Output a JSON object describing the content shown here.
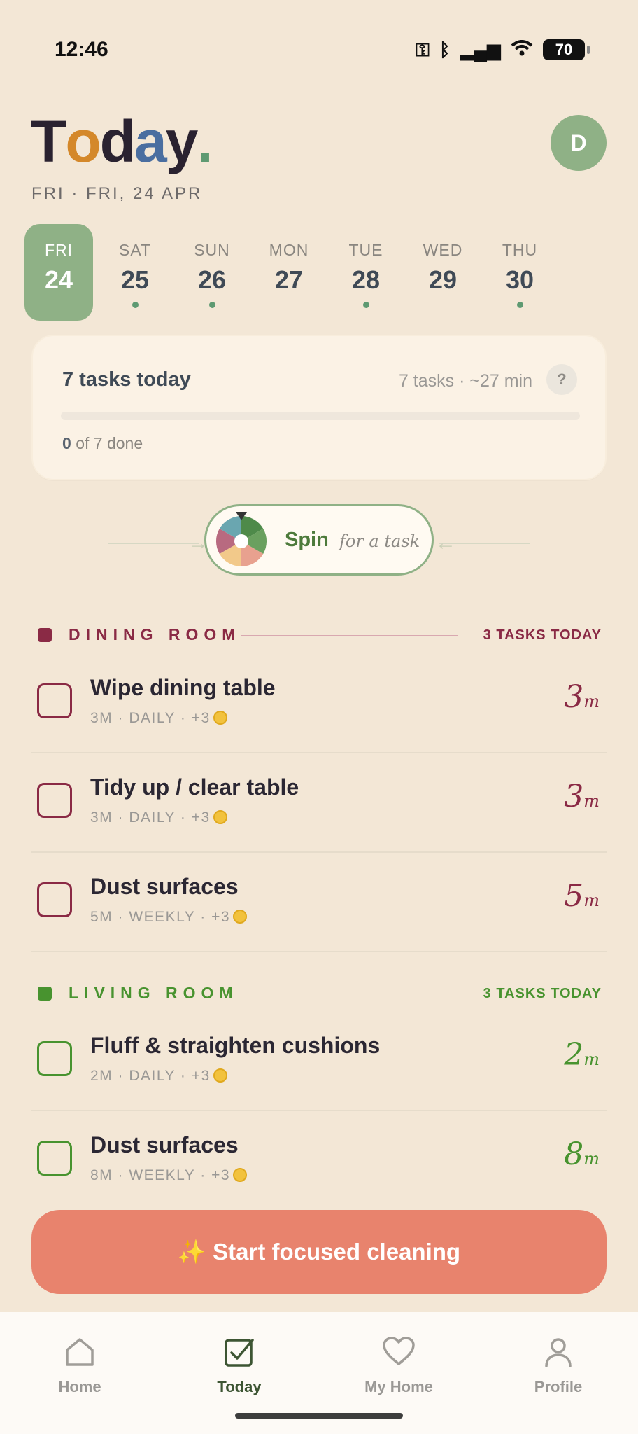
{
  "status_bar": {
    "time": "12:46",
    "battery": "70"
  },
  "header": {
    "title_letters": [
      {
        "ch": "T",
        "color": "#2a2230"
      },
      {
        "ch": "o",
        "color": "#d4882a"
      },
      {
        "ch": "d",
        "color": "#2a2230"
      },
      {
        "ch": "a",
        "color": "#4a6ea0"
      },
      {
        "ch": "y",
        "color": "#2a2230"
      },
      {
        "ch": ".",
        "color": "#5e9a72"
      }
    ],
    "subtitle": "FRI · FRI, 24 APR",
    "avatar_initial": "D"
  },
  "week": [
    {
      "name": "FRI",
      "num": "24",
      "active": true,
      "dot": false
    },
    {
      "name": "SAT",
      "num": "25",
      "active": false,
      "dot": true
    },
    {
      "name": "SUN",
      "num": "26",
      "active": false,
      "dot": true
    },
    {
      "name": "MON",
      "num": "27",
      "active": false,
      "dot": false
    },
    {
      "name": "TUE",
      "num": "28",
      "active": false,
      "dot": true
    },
    {
      "name": "WED",
      "num": "29",
      "active": false,
      "dot": false
    },
    {
      "name": "THU",
      "num": "30",
      "active": false,
      "dot": true
    }
  ],
  "summary": {
    "title": "7 tasks today",
    "meta": "7 tasks · ~27 min",
    "help": "?",
    "done_count": "0",
    "done_suffix": "of 7 done",
    "progress": 0
  },
  "spin": {
    "label": "Spin",
    "sub": "for a task"
  },
  "sections": {
    "dining": {
      "name": "DINING ROOM",
      "count": "3 TASKS TODAY",
      "color": "#8a2a45"
    },
    "living": {
      "name": "LIVING ROOM",
      "count": "3 TASKS TODAY",
      "color": "#48932f"
    }
  },
  "tasks": [
    {
      "name": "Wipe dining table",
      "meta": "3M · DAILY · +3",
      "dur": "3",
      "unit": "m"
    },
    {
      "name": "Tidy up / clear table",
      "meta": "3M · DAILY · +3",
      "dur": "3",
      "unit": "m"
    },
    {
      "name": "Dust surfaces",
      "meta": "5M · WEEKLY · +3",
      "dur": "5",
      "unit": "m"
    },
    {
      "name": "Fluff & straighten cushions",
      "meta": "2M · DAILY · +3",
      "dur": "2",
      "unit": "m"
    },
    {
      "name": "Dust surfaces",
      "meta": "8M · WEEKLY · +3",
      "dur": "8",
      "unit": "m"
    }
  ],
  "cta": {
    "label": "✨ Start focused cleaning"
  },
  "tabs": [
    {
      "label": "Home",
      "icon": "home-icon",
      "active": false
    },
    {
      "label": "Today",
      "icon": "checkbox-icon",
      "active": true
    },
    {
      "label": "My Home",
      "icon": "heart-icon",
      "active": false
    },
    {
      "label": "Profile",
      "icon": "user-icon",
      "active": false
    }
  ]
}
